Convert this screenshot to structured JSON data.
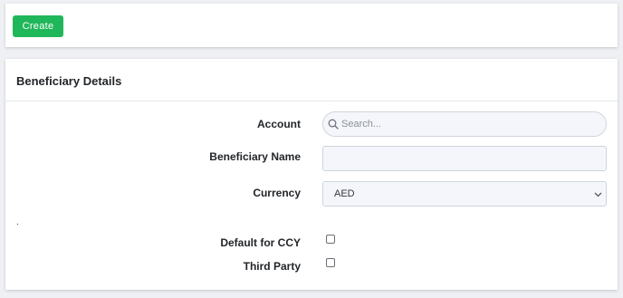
{
  "toolbar": {
    "create_label": "Create"
  },
  "form": {
    "title": "Beneficiary Details",
    "account": {
      "label": "Account",
      "placeholder": "Search..."
    },
    "beneficiary_name": {
      "label": "Beneficiary Name",
      "value": ""
    },
    "currency": {
      "label": "Currency",
      "selected": "AED"
    },
    "separator_dot": ".",
    "default_for_ccy": {
      "label": "Default for CCY",
      "checked": false
    },
    "third_party": {
      "label": "Third Party",
      "checked": false
    }
  },
  "colors": {
    "accent": "#20b75a",
    "background": "#eef0f4",
    "field_bg": "#f4f6fb"
  }
}
